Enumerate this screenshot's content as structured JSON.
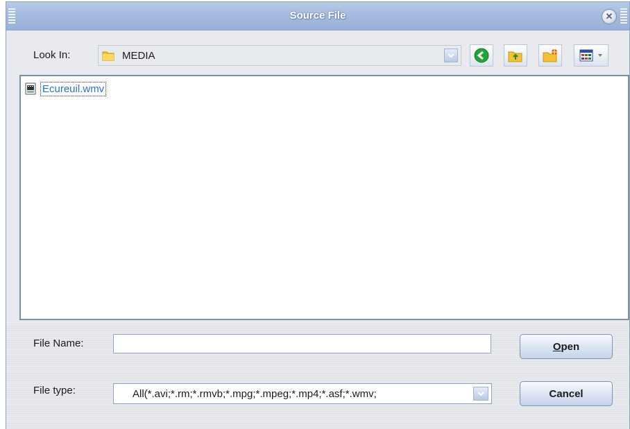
{
  "window": {
    "title": "Source File"
  },
  "toolbar": {
    "look_in_label": "Look In:",
    "look_in_value": "MEDIA",
    "buttons": [
      "back",
      "up-folder",
      "new-folder",
      "view-menu"
    ]
  },
  "file_list": {
    "items": [
      {
        "name": "Ecureuil.wmv",
        "icon": "video-file-icon",
        "focused": true
      }
    ]
  },
  "form": {
    "file_name_label": "File Name:",
    "file_name_value": "",
    "file_type_label": "File type:",
    "file_type_value": "All(*.avi;*.rm;*.rmvb;*.mpg;*.mpeg;*.mp4;*.asf;*.wmv;",
    "open_label_accel": "O",
    "open_label_rest": "pen",
    "cancel_label": "Cancel"
  },
  "colors": {
    "title_bar": "#a4bbdf",
    "file_link": "#2b6fd6",
    "back_button_green": "#21a336",
    "folder_yellow": "#f3c22c"
  }
}
